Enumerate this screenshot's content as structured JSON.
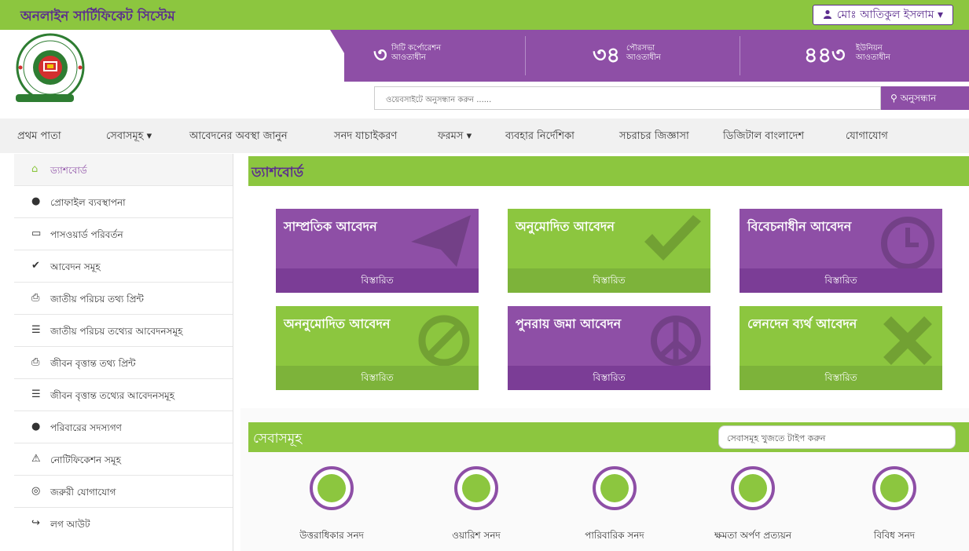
{
  "topbar": {
    "title": "অনলাইন সার্টিফিকেট সিস্টেম",
    "user": "মোঃ আতিকুল ইসলাম"
  },
  "stats": [
    {
      "num": "৩",
      "line1": "সিটি কর্পোরেশন",
      "line2": "আওতাধীন"
    },
    {
      "num": "৩৪",
      "line1": "পৌরসভা",
      "line2": "আওতাধীন"
    },
    {
      "num": "৪৪৩",
      "line1": "ইউনিয়ন",
      "line2": "আওতাধীন"
    }
  ],
  "search": {
    "placeholder": "ওয়েবসাইটে অনুসন্ধান করুন ......",
    "button": "অনুসন্ধান"
  },
  "menu": [
    "প্রথম পাতা",
    "সেবাসমূহ",
    "আবেদনের অবস্থা জানুন",
    "সনদ যাচাইকরণ",
    "ফরমস",
    "ব্যবহার নির্দেশিকা",
    "সচরাচর জিজ্ঞাসা",
    "ডিজিটাল বাংলাদেশ",
    "যোগাযোগ"
  ],
  "sidebar": [
    {
      "label": "ড্যাশবোর্ড",
      "icon": "home-icon"
    },
    {
      "label": "প্রোফাইল ব্যবস্থাপনা",
      "icon": "user-icon"
    },
    {
      "label": "পাসওয়ার্ড পরিবর্তন",
      "icon": "lock-icon"
    },
    {
      "label": "আবেদন সমূহ",
      "icon": "check-icon"
    },
    {
      "label": "জাতীয় পরিচয় তথ্য প্রিন্ট",
      "icon": "print-icon"
    },
    {
      "label": "জাতীয় পরিচয় তথ্যের আবেদনসমূহ",
      "icon": "list-icon"
    },
    {
      "label": "জীবন বৃত্তান্ত তথ্য প্রিন্ট",
      "icon": "print-icon"
    },
    {
      "label": "জীবন বৃত্তান্ত তথ্যের আবেদনসমূহ",
      "icon": "list-icon"
    },
    {
      "label": "পরিবারের সদস্যগণ",
      "icon": "user-icon"
    },
    {
      "label": "নোটিফিকেশন সমূহ",
      "icon": "warning-icon"
    },
    {
      "label": "জরুরী যোগাযোগ",
      "icon": "life-ring-icon"
    },
    {
      "label": "লগ আউট",
      "icon": "logout-icon"
    }
  ],
  "dashboard": {
    "title": "ড্যাশবোর্ড",
    "cards": [
      {
        "title": "সাম্প্রতিক আবেদন",
        "footer": "বিস্তারিত",
        "color": "purple",
        "icon": "paper-plane-icon"
      },
      {
        "title": "অনুমোদিত আবেদন",
        "footer": "বিস্তারিত",
        "color": "green",
        "icon": "check-icon"
      },
      {
        "title": "বিবেচনাধীন আবেদন",
        "footer": "বিস্তারিত",
        "color": "purple",
        "icon": "clock-icon"
      },
      {
        "title": "অননুমোদিত আবেদন",
        "footer": "বিস্তারিত",
        "color": "green",
        "icon": "ban-icon"
      },
      {
        "title": "পুনরায় জমা আবেদন",
        "footer": "বিস্তারিত",
        "color": "purple",
        "icon": "peace-icon"
      },
      {
        "title": "লেনদেন ব্যর্থ আবেদন",
        "footer": "বিস্তারিত",
        "color": "green",
        "icon": "close-icon"
      }
    ]
  },
  "services": {
    "title": "সেবাসমূহ",
    "search_placeholder": "সেবাসমূহ খুজতে টাইপ করুন",
    "items": [
      {
        "label": "উত্তরাধিকার সনদ",
        "icon": "document-icon"
      },
      {
        "label": "ওয়ারিশ সনদ",
        "icon": "person-document-icon"
      },
      {
        "label": "পারিবারিক সনদ",
        "icon": "family-icon"
      },
      {
        "label": "ক্ষমতা অর্পণ প্রত্যয়ন",
        "icon": "handover-icon"
      },
      {
        "label": "বিবিধ সনদ",
        "icon": "certificate-icon"
      }
    ]
  },
  "colors": {
    "green": "#8cc63f",
    "purple": "#8e4fa6",
    "dark_purple": "#5b2d8e"
  }
}
